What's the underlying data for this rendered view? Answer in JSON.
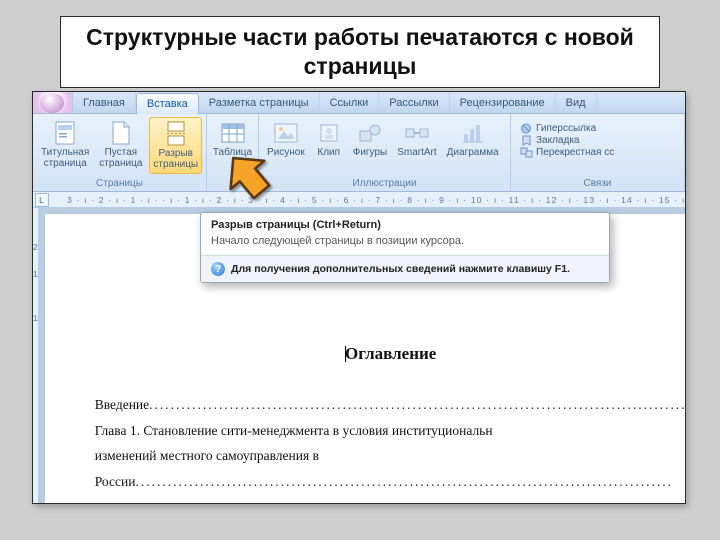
{
  "slide": {
    "title": "Структурные части работы печатаются с новой страницы"
  },
  "tabs": {
    "home": "Главная",
    "insert": "Вставка",
    "layout": "Разметка страницы",
    "refs": "Ссылки",
    "mail": "Рассылки",
    "review": "Рецензирование",
    "view": "Вид"
  },
  "ribbon": {
    "pages": {
      "label": "Страницы",
      "title_page": "Титульная\nстраница",
      "blank_page": "Пустая\nстраница",
      "page_break": "Разрыв\nстраницы"
    },
    "tables": {
      "label": "",
      "table": "Таблица"
    },
    "illustrations": {
      "label": "Иллюстрации",
      "picture": "Рисунок",
      "clip": "Клип",
      "shapes": "Фигуры",
      "smartart": "SmartArt",
      "chart": "Диаграмма"
    },
    "links": {
      "label": "Связи",
      "hyperlink": "Гиперссылка",
      "bookmark": "Закладка",
      "crossref": "Перекрестная сс"
    }
  },
  "tooltip": {
    "title": "Разрыв страницы (Ctrl+Return)",
    "body": "Начало следующей страницы в позиции курсора.",
    "help": "Для получения дополнительных сведений нажмите клавишу F1."
  },
  "ruler": {
    "horizontal": "3 · ı · 2 · ı · 1 · ı ·   · ı · 1 · ı · 2 · ı · 3 · ı · 4 · ı · 5 · ı · 6 · ı · 7 · ı · 8 · ı · 9 · ı · 10 · ı · 11 · ı · 12 · ı · 13 · ı · 14 · ı · 15 · ı · 16 ·",
    "corner": "L",
    "vertical": [
      "2",
      "1",
      "",
      "1"
    ]
  },
  "document": {
    "title": "Оглавление",
    "intro": "Введение",
    "ch1a": "Глава 1. Становление сити-менеджмента в условия институциональн",
    "ch1b": "изменений местного самоуправления в России"
  }
}
